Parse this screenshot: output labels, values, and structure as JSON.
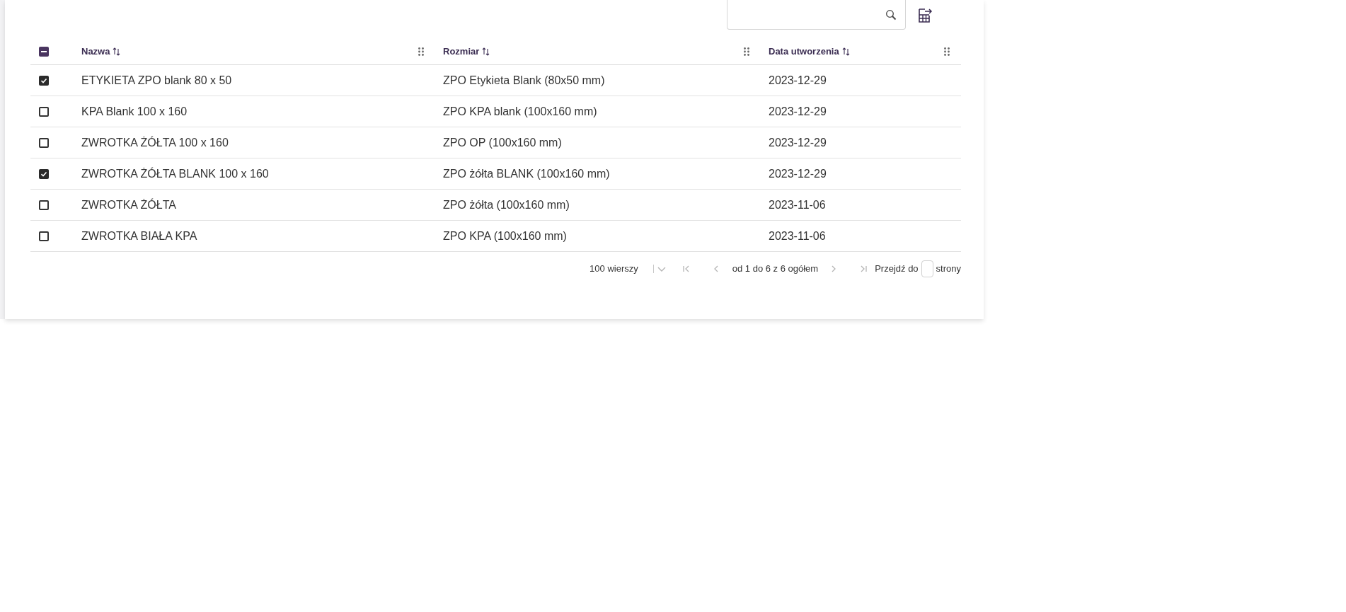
{
  "toolbar": {
    "search": {
      "kind": "search"
    },
    "export": {
      "kind": "export"
    }
  },
  "table": {
    "select_all": {
      "indeterminate": true
    },
    "columns": [
      {
        "label": "Nazwa"
      },
      {
        "label": "Rozmiar"
      },
      {
        "label": "Data utworzenia"
      }
    ],
    "rows": [
      {
        "selected": true,
        "cells": [
          "ETYKIETA ZPO blank 80 x 50",
          "ZPO Etykieta Blank (80x50 mm)",
          "2023-12-29"
        ]
      },
      {
        "selected": false,
        "cells": [
          "KPA Blank 100 x 160",
          "ZPO KPA blank (100x160 mm)",
          "2023-12-29"
        ]
      },
      {
        "selected": false,
        "cells": [
          "ZWROTKA ŻÓŁTA 100 x 160",
          "ZPO OP (100x160 mm)",
          "2023-12-29"
        ]
      },
      {
        "selected": true,
        "cells": [
          "ZWROTKA ŻÓŁTA BLANK 100 x 160",
          "ZPO żółta BLANK (100x160 mm)",
          "2023-12-29"
        ]
      },
      {
        "selected": false,
        "cells": [
          "ZWROTKA ŻÓŁTA",
          "ZPO żółta (100x160 mm)",
          "2023-11-06"
        ]
      },
      {
        "selected": false,
        "cells": [
          "ZWROTKA BIAŁA KPA",
          "ZPO KPA (100x160 mm)",
          "2023-11-06"
        ]
      }
    ]
  },
  "pagination": {
    "rows_per_page": "100 wierszy",
    "range": "od 1 do 6 z 6 ogółem",
    "goto_label": "Przejdź do",
    "goto_suffix": "strony",
    "nav": [
      {
        "kind": "first",
        "disabled": true
      },
      {
        "kind": "prev",
        "disabled": true
      },
      {
        "kind": "next",
        "disabled": true
      },
      {
        "kind": "last",
        "disabled": true
      }
    ]
  }
}
